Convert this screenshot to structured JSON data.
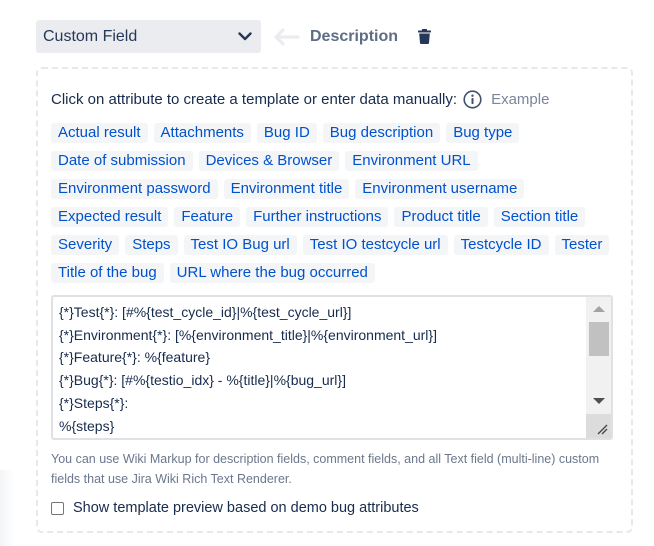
{
  "field_mapping": {
    "source_select": {
      "selected": "Custom Field",
      "icon": "chevron-down-icon"
    },
    "arrow_icon": "arrow-left-icon",
    "target_field": "Description",
    "delete_icon": "trash-icon"
  },
  "template_panel": {
    "hint": "Click on attribute to create a template or enter data manually:",
    "info_icon": "info-icon",
    "example_link": "Example",
    "attributes": [
      "Actual result",
      "Attachments",
      "Bug ID",
      "Bug description",
      "Bug type",
      "Date of submission",
      "Devices & Browser",
      "Environment URL",
      "Environment password",
      "Environment title",
      "Environment username",
      "Expected result",
      "Feature",
      "Further instructions",
      "Product title",
      "Section title",
      "Severity",
      "Steps",
      "Test IO Bug url",
      "Test IO testcycle url",
      "Testcycle ID",
      "Tester",
      "Title of the bug",
      "URL where the bug occurred"
    ],
    "template_text": "{*}Test{*}: [#%{test_cycle_id}|%{test_cycle_url}]\n{*}Environment{*}: [%{environment_title}|%{environment_url}]\n{*}Feature{*}: %{feature}\n{*}Bug{*}: [#%{testio_idx} - %{title}|%{bug_url}]\n{*}Steps{*}:\n%{steps}",
    "help_text": "You can use Wiki Markup for description fields, comment fields, and all Text field (multi-line) custom fields that use Jira Wiki Rich Text Renderer.",
    "preview_checkbox": {
      "label": "Show template preview based on demo bug attributes",
      "checked": false
    }
  },
  "colors": {
    "chip_text": "#0052cc",
    "chip_bg": "#f4f5f7",
    "select_bg": "#ebecf0",
    "muted_text": "#6b778c",
    "panel_border": "#e6e8ec"
  }
}
